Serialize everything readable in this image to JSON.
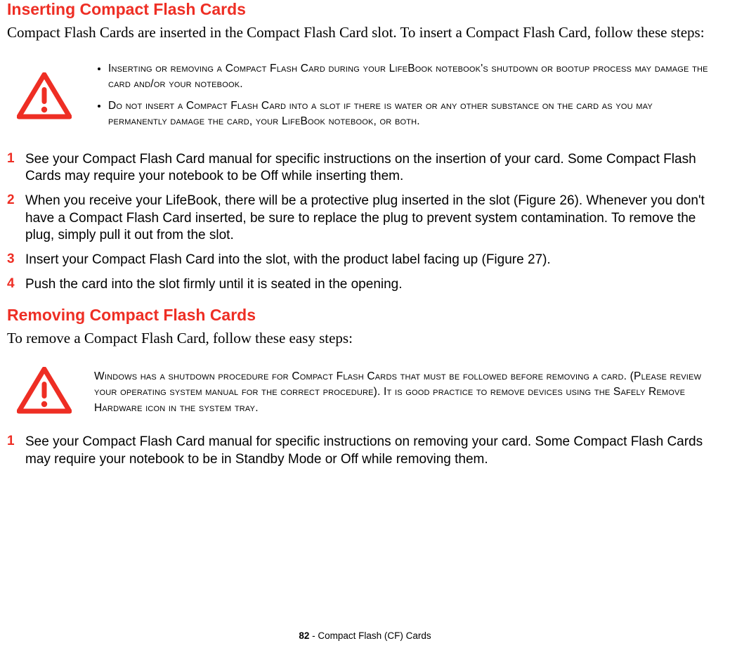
{
  "section1": {
    "heading": "Inserting Compact Flash Cards",
    "intro": "Compact Flash Cards are inserted in the Compact Flash Card slot. To insert a Compact Flash Card, follow these steps:",
    "warning": {
      "items": [
        "Inserting or removing a Compact Flash Card during your LifeBook notebook's shutdown or bootup process may damage the card and/or your notebook.",
        "Do not insert a Compact Flash Card into a slot if there is water or any other substance on the card as you may permanently damage the card, your LifeBook notebook, or both."
      ]
    },
    "steps": {
      "n1": "1",
      "t1": "See your Compact Flash Card manual for specific instructions on the insertion of your card. Some Compact Flash Cards may require your notebook to be Off while inserting them.",
      "n2": "2",
      "t2": "When you receive your LifeBook, there will be a protective plug inserted in the slot (Figure 26). Whenever you don't have a Compact Flash Card inserted, be sure to replace the plug to prevent system contamination. To remove the plug, simply pull it out from the slot.",
      "n3": "3",
      "t3": "Insert your Compact Flash Card into the slot, with the product label facing up (Figure 27).",
      "n4": "4",
      "t4": "Push the card into the slot firmly until it is seated in the opening."
    }
  },
  "section2": {
    "heading": "Removing Compact Flash Cards",
    "intro": "To remove a Compact Flash Card, follow these easy steps:",
    "warning": {
      "text": "Windows has a shutdown procedure for Compact Flash Cards that must be followed before removing a card. (Please review your operating system manual for the correct procedure). It is good practice to remove devices using the Safely Remove Hardware icon in the system tray."
    },
    "steps": {
      "n1": "1",
      "t1": "See your Compact Flash Card manual for specific instructions on removing your card. Some Compact Flash Cards may require your notebook to be in Standby Mode or Off while removing them."
    }
  },
  "footer": {
    "page": "82",
    "sep": " - ",
    "title": "Compact Flash (CF) Cards"
  },
  "colors": {
    "accent": "#ee2e24"
  }
}
